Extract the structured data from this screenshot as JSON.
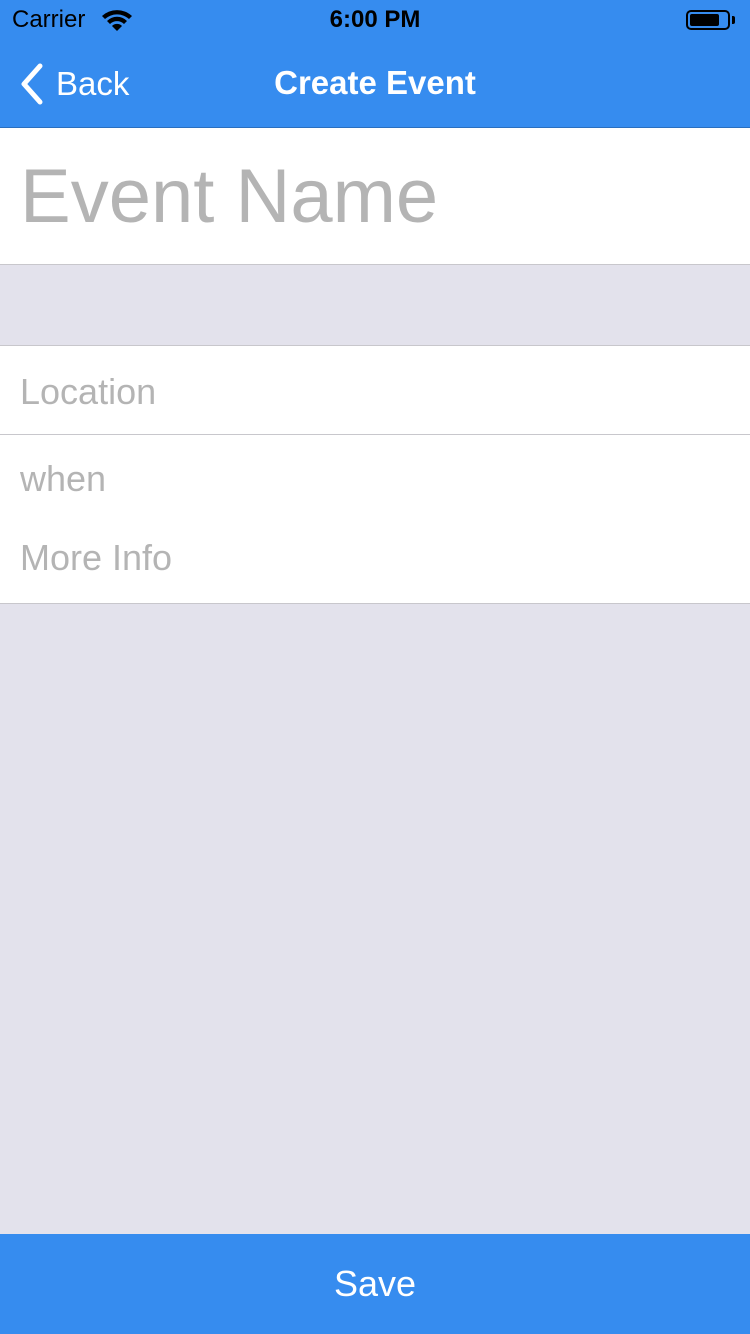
{
  "status_bar": {
    "carrier": "Carrier",
    "time": "6:00 PM",
    "wifi_icon": "wifi-icon",
    "battery_icon": "battery-icon",
    "battery_level": 0.85
  },
  "nav_bar": {
    "back_label": "Back",
    "back_icon": "chevron-left-icon",
    "title": "Create Event"
  },
  "form": {
    "event_name": {
      "value": "",
      "placeholder": "Event Name"
    },
    "location": {
      "value": "",
      "placeholder": "Location"
    },
    "when": {
      "label": "when"
    },
    "more_info": {
      "value": "",
      "placeholder": "More Info"
    }
  },
  "footer": {
    "save_label": "Save"
  },
  "colors": {
    "accent": "#368cef",
    "placeholder": "#b4b4b4",
    "background": "#e3e2ec",
    "separator": "#c8c7cc"
  }
}
